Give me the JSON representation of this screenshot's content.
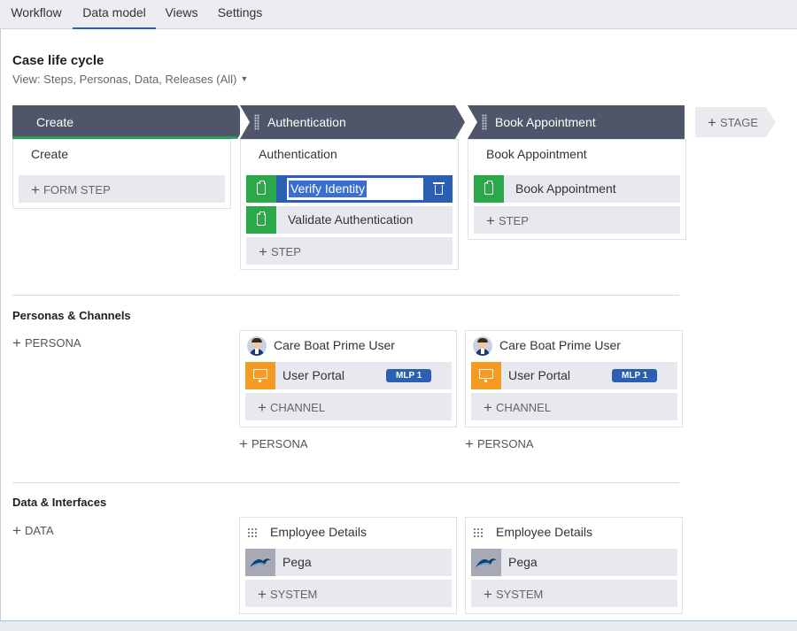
{
  "tabs": [
    {
      "label": "Workflow"
    },
    {
      "label": "Data model"
    },
    {
      "label": "Views"
    },
    {
      "label": "Settings"
    }
  ],
  "page": {
    "title": "Case life cycle",
    "view_label": "View: Steps, Personas, Data, Releases (All)"
  },
  "stages": [
    {
      "label": "Create"
    },
    {
      "label": "Authentication"
    },
    {
      "label": "Book Appointment"
    }
  ],
  "add_stage_label": "STAGE",
  "lifecycle": {
    "create": {
      "title": "Create",
      "add_label": "FORM STEP"
    },
    "authentication": {
      "title": "Authentication",
      "editing_value": "Verify Identity",
      "step2": "Validate Authentication",
      "add_label": "STEP"
    },
    "book": {
      "title": "Book Appointment",
      "step1": "Book Appointment",
      "add_label": "STEP"
    }
  },
  "personas": {
    "section_title": "Personas & Channels",
    "add_persona": "PERSONA",
    "cards": [
      {
        "name": "Care Boat Prime User",
        "channel": "User Portal",
        "release": "MLP 1",
        "add_channel": "CHANNEL",
        "add_persona": "PERSONA"
      },
      {
        "name": "Care Boat Prime User",
        "channel": "User Portal",
        "release": "MLP 1",
        "add_channel": "CHANNEL",
        "add_persona": "PERSONA"
      }
    ]
  },
  "data": {
    "section_title": "Data & Interfaces",
    "add_data": "DATA",
    "cards": [
      {
        "name": "Employee Details",
        "system": "Pega",
        "add_system": "SYSTEM"
      },
      {
        "name": "Employee Details",
        "system": "Pega",
        "add_system": "SYSTEM"
      }
    ]
  },
  "colors": {
    "stage_bg": "#50566a",
    "accent_blue": "#2a5fb3",
    "step_green": "#2aa84a",
    "channel_orange": "#f59a23",
    "stage_active_underline": "#2e9d5a"
  },
  "icons": [
    "clipboard-icon",
    "trash-icon",
    "monitor-icon",
    "avatar-icon",
    "drag-handle-icon",
    "plus-icon",
    "pega-logo-icon"
  ]
}
